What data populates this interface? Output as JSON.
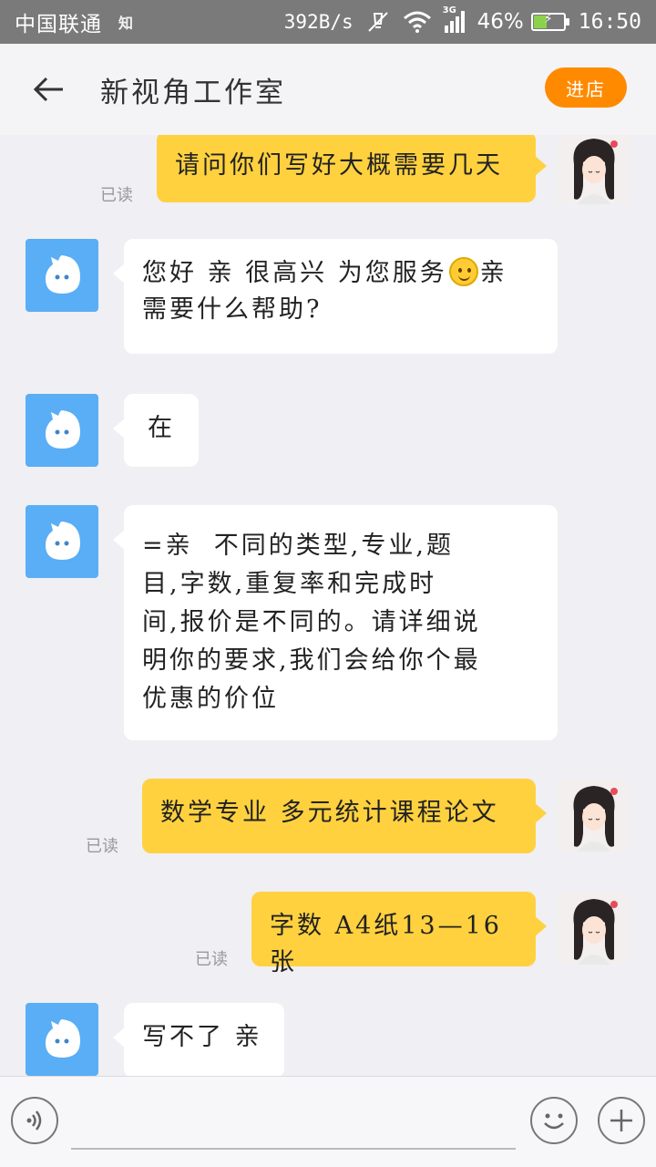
{
  "status_bar": {
    "carrier": "中国联通",
    "app_badge": "知",
    "net_speed": "392B/s",
    "network_type": "3G",
    "battery": "46%",
    "battery_level": 0.46,
    "time": "16:50"
  },
  "header": {
    "title": "新视角工作室",
    "enter_shop_label": "进店"
  },
  "messages": [
    {
      "side": "out",
      "text": "请问你们写好大概需要几天",
      "read_label": "已读"
    },
    {
      "side": "in",
      "line1": "您好 亲 很高兴 为您服务",
      "line1_after_emoji": "亲",
      "line2": "需要什么帮助?",
      "emoji": "smile-emoji"
    },
    {
      "side": "in",
      "text": "在"
    },
    {
      "side": "in",
      "lines": [
        "=亲  不同的类型,专业,题",
        "目,字数,重复率和完成时",
        "间,报价是不同的。请详细说",
        "明你的要求,我们会给你个最",
        "优惠的价位"
      ]
    },
    {
      "side": "out",
      "text": "数学专业 多元统计课程论文",
      "read_label": "已读"
    },
    {
      "side": "out",
      "text": "字数 A4纸13—16张",
      "read_label": "已读"
    },
    {
      "side": "in",
      "text": "写不了 亲"
    }
  ],
  "input_bar": {
    "message_placeholder": "",
    "icons": [
      "voice-icon",
      "emoji-icon",
      "plus-icon"
    ]
  },
  "colors": {
    "outgoing_bubble": "#ffd13f",
    "incoming_bubble": "#ffffff",
    "shop_button": "#ff8a00",
    "service_avatar": "#5aaef5"
  }
}
